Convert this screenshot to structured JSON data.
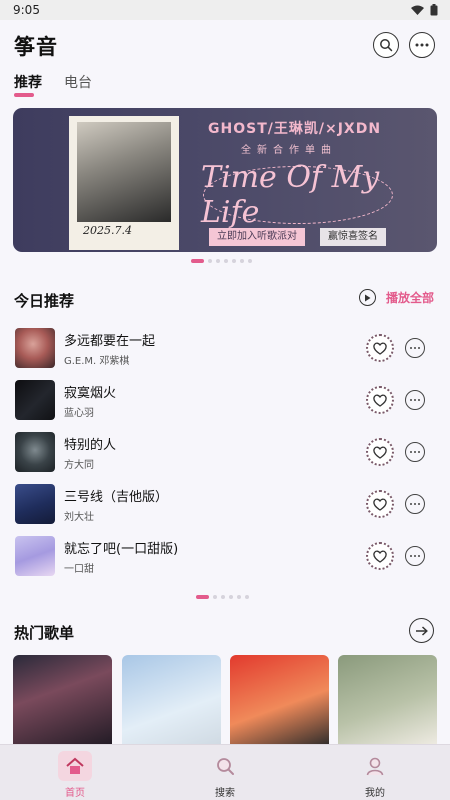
{
  "status": {
    "time": "9:05"
  },
  "header": {
    "title": "筝音"
  },
  "tabs": [
    {
      "label": "推荐"
    },
    {
      "label": "电台"
    }
  ],
  "banner": {
    "artist": "GHOST/王琳凯/×JXDN",
    "subtitle": "全新合作单曲",
    "song_title": "Time Of My Life",
    "button_join": "立即加入听歌派对",
    "button_sign": "赢惊喜签名",
    "signature": "2025.7.4"
  },
  "today": {
    "title": "今日推荐",
    "play_all": "播放全部",
    "songs": [
      {
        "title": "多远都要在一起",
        "artist": "G.E.M. 邓紫棋"
      },
      {
        "title": "寂寞烟火",
        "artist": "蓝心羽"
      },
      {
        "title": "特别的人",
        "artist": "方大同"
      },
      {
        "title": "三号线（吉他版）",
        "artist": "刘大壮"
      },
      {
        "title": "就忘了吧(一口甜版)",
        "artist": "一口甜"
      }
    ]
  },
  "playlists": {
    "title": "热门歌单"
  },
  "nav": [
    {
      "label": "首页"
    },
    {
      "label": "搜索"
    },
    {
      "label": "我的"
    }
  ],
  "colors": {
    "accent": "#e35b8c",
    "background": "#f7f6fb"
  }
}
